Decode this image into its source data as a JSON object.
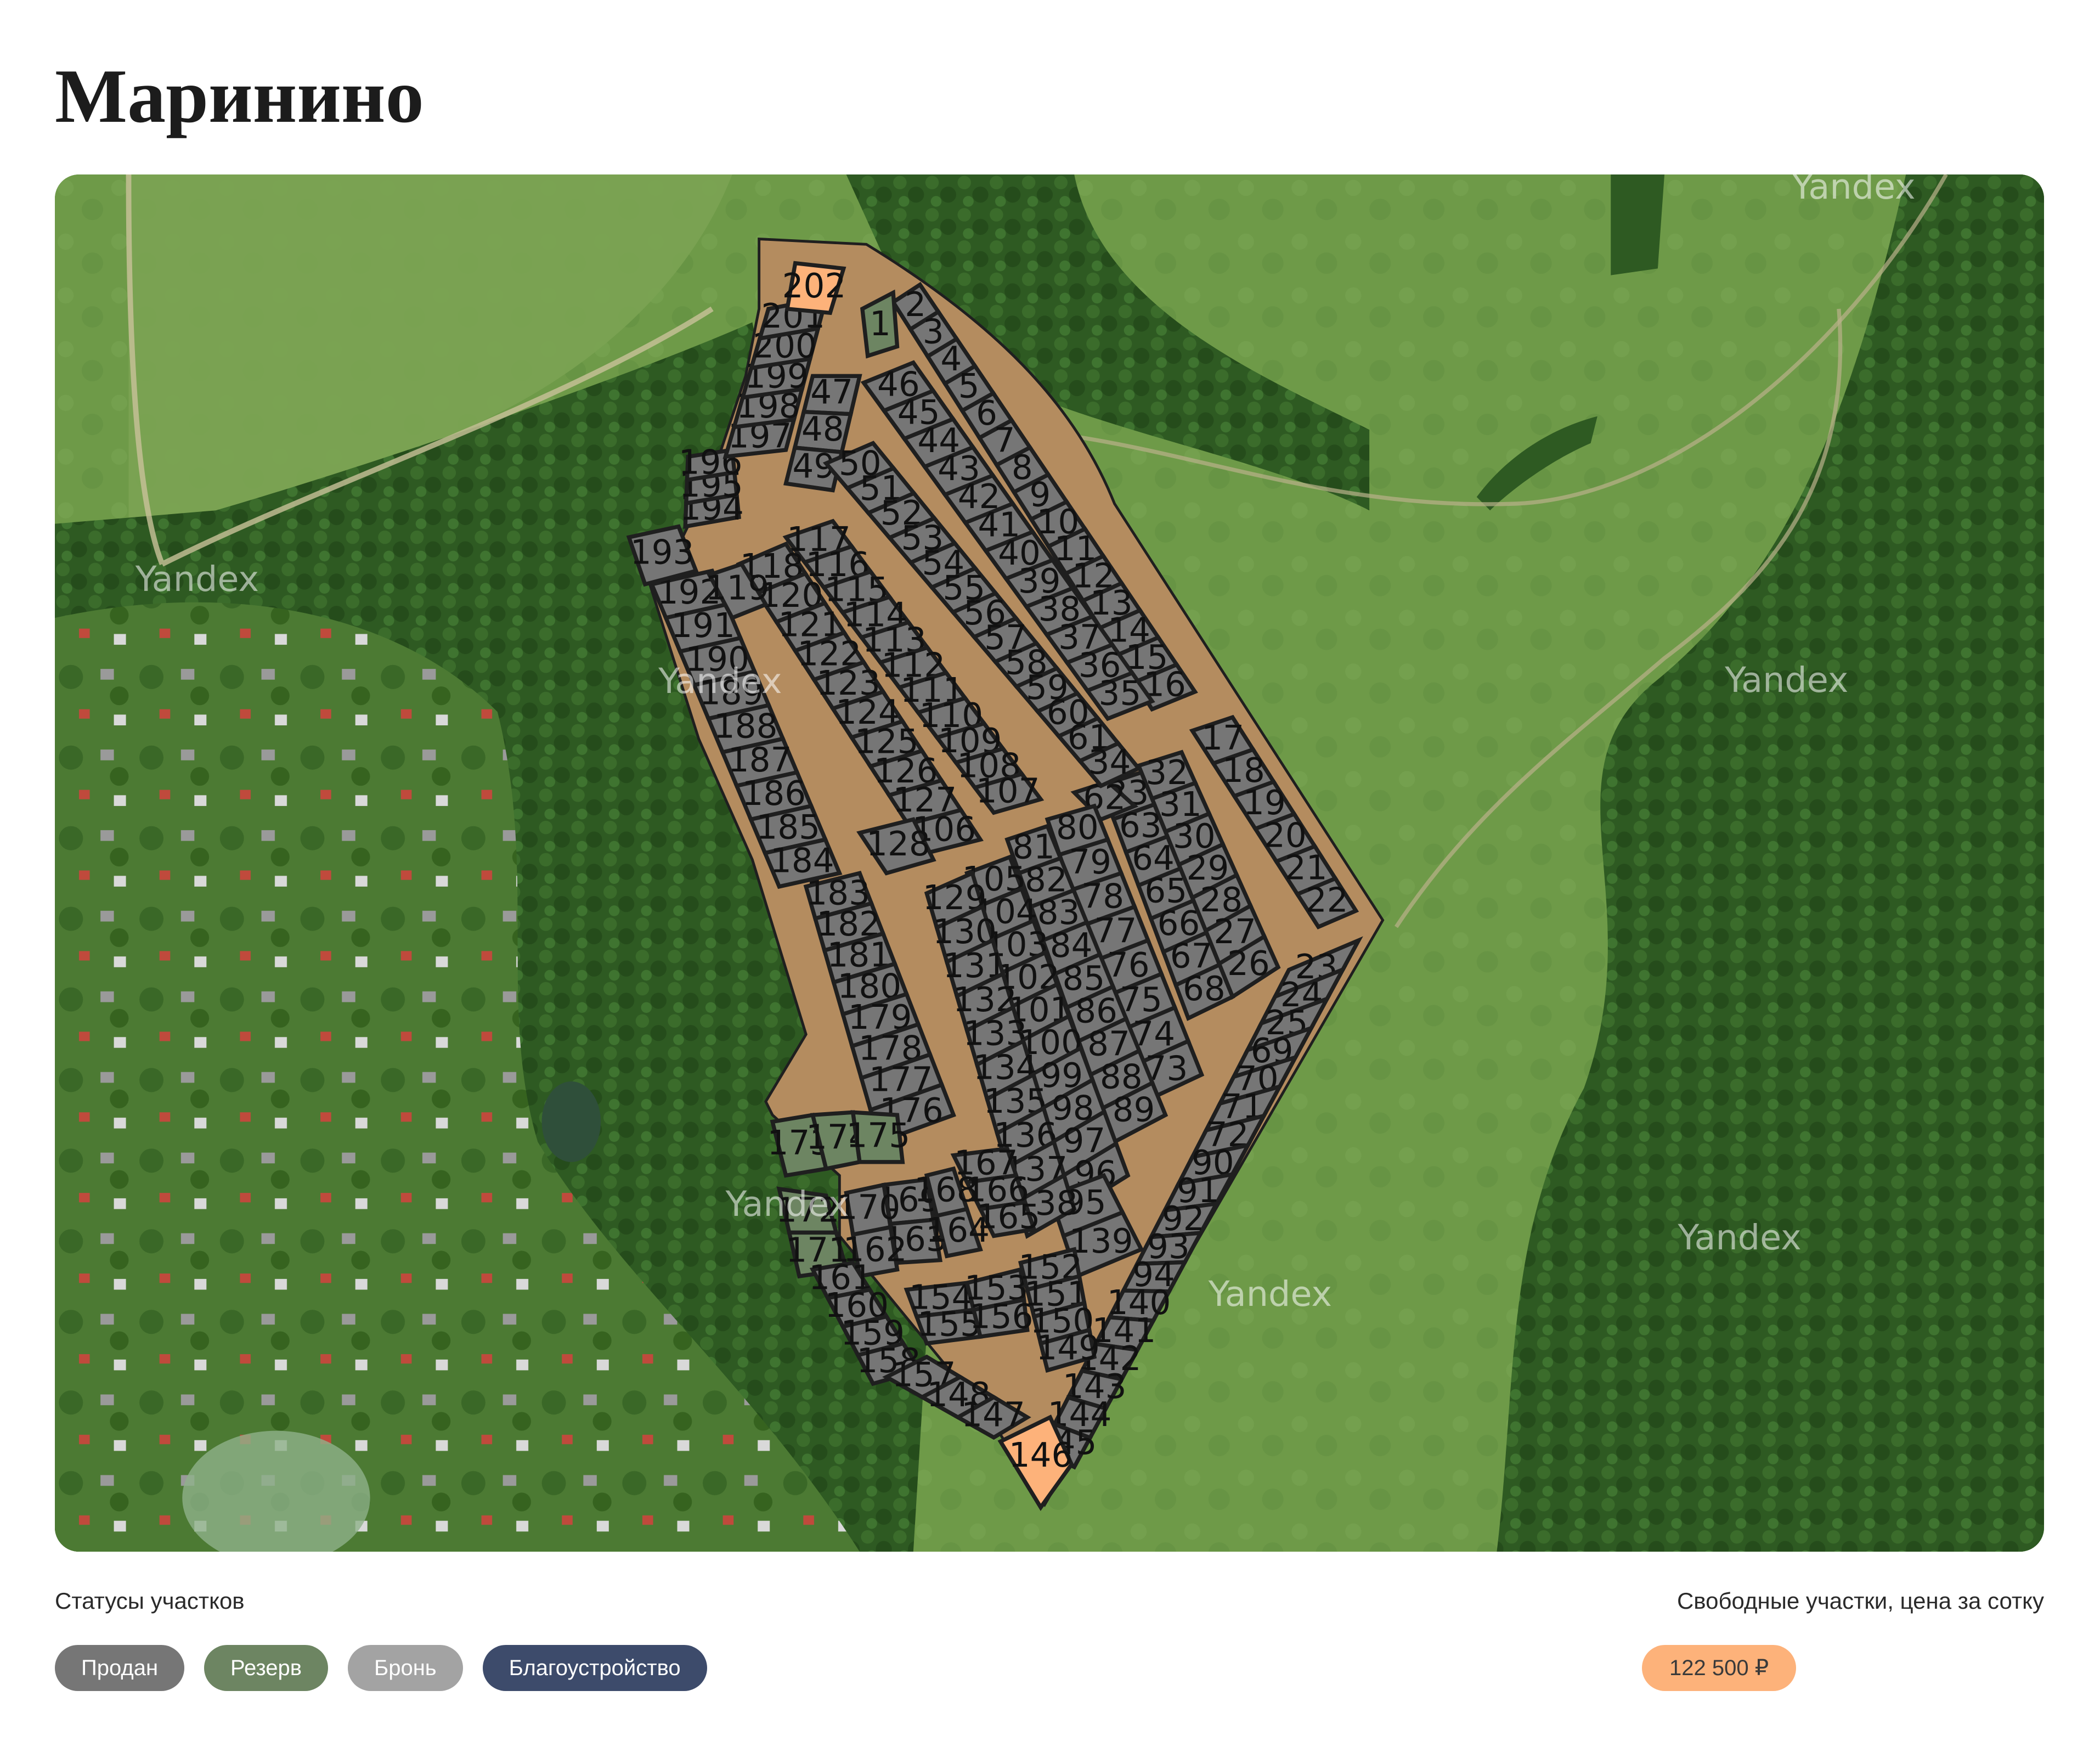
{
  "page": {
    "title": "Маринино"
  },
  "legend": {
    "title": "Статусы участков",
    "statuses": [
      {
        "label": "Продан",
        "color": "#767676"
      },
      {
        "label": "Резерв",
        "color": "#6d8562"
      },
      {
        "label": "Бронь",
        "color": "#a3a3a3"
      },
      {
        "label": "Благоустройство",
        "color": "#3d4b6b"
      }
    ]
  },
  "price": {
    "title": "Свободные участки, цена за сотку",
    "value": "122 500 ₽",
    "color": "#fdb27a"
  },
  "map": {
    "watermark": "Yandex",
    "colors": {
      "sold": "#767676",
      "reserve": "#6d8562",
      "available": "#fdb27a",
      "road": "#b48c5f",
      "field": "#6f9a48",
      "forest": "#2f5a21"
    },
    "plots": [
      {
        "n": "1",
        "s": "reserve"
      },
      {
        "n": "2",
        "s": "sold"
      },
      {
        "n": "3",
        "s": "sold"
      },
      {
        "n": "4",
        "s": "sold"
      },
      {
        "n": "5",
        "s": "sold"
      },
      {
        "n": "6",
        "s": "sold"
      },
      {
        "n": "7",
        "s": "sold"
      },
      {
        "n": "8",
        "s": "sold"
      },
      {
        "n": "9",
        "s": "sold"
      },
      {
        "n": "10",
        "s": "sold"
      },
      {
        "n": "11",
        "s": "sold"
      },
      {
        "n": "12",
        "s": "sold"
      },
      {
        "n": "13",
        "s": "sold"
      },
      {
        "n": "14",
        "s": "sold"
      },
      {
        "n": "15",
        "s": "sold"
      },
      {
        "n": "16",
        "s": "sold"
      },
      {
        "n": "17",
        "s": "sold"
      },
      {
        "n": "18",
        "s": "sold"
      },
      {
        "n": "19",
        "s": "sold"
      },
      {
        "n": "20",
        "s": "sold"
      },
      {
        "n": "21",
        "s": "sold"
      },
      {
        "n": "22",
        "s": "sold"
      },
      {
        "n": "23",
        "s": "sold"
      },
      {
        "n": "24",
        "s": "sold"
      },
      {
        "n": "25",
        "s": "sold"
      },
      {
        "n": "26",
        "s": "sold"
      },
      {
        "n": "27",
        "s": "sold"
      },
      {
        "n": "28",
        "s": "sold"
      },
      {
        "n": "29",
        "s": "sold"
      },
      {
        "n": "30",
        "s": "sold"
      },
      {
        "n": "31",
        "s": "sold"
      },
      {
        "n": "32",
        "s": "sold"
      },
      {
        "n": "33",
        "s": "sold"
      },
      {
        "n": "34",
        "s": "sold"
      },
      {
        "n": "35",
        "s": "sold"
      },
      {
        "n": "36",
        "s": "sold"
      },
      {
        "n": "37",
        "s": "sold"
      },
      {
        "n": "38",
        "s": "sold"
      },
      {
        "n": "39",
        "s": "sold"
      },
      {
        "n": "40",
        "s": "sold"
      },
      {
        "n": "41",
        "s": "sold"
      },
      {
        "n": "42",
        "s": "sold"
      },
      {
        "n": "43",
        "s": "sold"
      },
      {
        "n": "44",
        "s": "sold"
      },
      {
        "n": "45",
        "s": "sold"
      },
      {
        "n": "46",
        "s": "sold"
      },
      {
        "n": "47",
        "s": "sold"
      },
      {
        "n": "48",
        "s": "sold"
      },
      {
        "n": "49",
        "s": "sold"
      },
      {
        "n": "50",
        "s": "sold"
      },
      {
        "n": "51",
        "s": "sold"
      },
      {
        "n": "52",
        "s": "sold"
      },
      {
        "n": "53",
        "s": "sold"
      },
      {
        "n": "54",
        "s": "sold"
      },
      {
        "n": "55",
        "s": "sold"
      },
      {
        "n": "56",
        "s": "sold"
      },
      {
        "n": "57",
        "s": "sold"
      },
      {
        "n": "58",
        "s": "sold"
      },
      {
        "n": "59",
        "s": "sold"
      },
      {
        "n": "60",
        "s": "sold"
      },
      {
        "n": "61",
        "s": "sold"
      },
      {
        "n": "62",
        "s": "sold"
      },
      {
        "n": "63",
        "s": "sold"
      },
      {
        "n": "64",
        "s": "sold"
      },
      {
        "n": "65",
        "s": "sold"
      },
      {
        "n": "66",
        "s": "sold"
      },
      {
        "n": "67",
        "s": "sold"
      },
      {
        "n": "68",
        "s": "sold"
      },
      {
        "n": "69",
        "s": "sold"
      },
      {
        "n": "70",
        "s": "sold"
      },
      {
        "n": "71",
        "s": "sold"
      },
      {
        "n": "72",
        "s": "sold"
      },
      {
        "n": "73",
        "s": "sold"
      },
      {
        "n": "74",
        "s": "sold"
      },
      {
        "n": "75",
        "s": "sold"
      },
      {
        "n": "76",
        "s": "sold"
      },
      {
        "n": "77",
        "s": "sold"
      },
      {
        "n": "78",
        "s": "sold"
      },
      {
        "n": "79",
        "s": "sold"
      },
      {
        "n": "80",
        "s": "sold"
      },
      {
        "n": "81",
        "s": "sold"
      },
      {
        "n": "82",
        "s": "sold"
      },
      {
        "n": "83",
        "s": "sold"
      },
      {
        "n": "84",
        "s": "sold"
      },
      {
        "n": "85",
        "s": "sold"
      },
      {
        "n": "86",
        "s": "sold"
      },
      {
        "n": "87",
        "s": "sold"
      },
      {
        "n": "88",
        "s": "sold"
      },
      {
        "n": "89",
        "s": "sold"
      },
      {
        "n": "90",
        "s": "sold"
      },
      {
        "n": "91",
        "s": "sold"
      },
      {
        "n": "92",
        "s": "sold"
      },
      {
        "n": "93",
        "s": "sold"
      },
      {
        "n": "94",
        "s": "sold"
      },
      {
        "n": "95",
        "s": "sold"
      },
      {
        "n": "96",
        "s": "sold"
      },
      {
        "n": "97",
        "s": "sold"
      },
      {
        "n": "98",
        "s": "sold"
      },
      {
        "n": "99",
        "s": "sold"
      },
      {
        "n": "100",
        "s": "sold"
      },
      {
        "n": "101",
        "s": "sold"
      },
      {
        "n": "102",
        "s": "sold"
      },
      {
        "n": "103",
        "s": "sold"
      },
      {
        "n": "104",
        "s": "sold"
      },
      {
        "n": "105",
        "s": "sold"
      },
      {
        "n": "106",
        "s": "sold"
      },
      {
        "n": "107",
        "s": "sold"
      },
      {
        "n": "108",
        "s": "sold"
      },
      {
        "n": "109",
        "s": "sold"
      },
      {
        "n": "110",
        "s": "sold"
      },
      {
        "n": "111",
        "s": "sold"
      },
      {
        "n": "112",
        "s": "sold"
      },
      {
        "n": "113",
        "s": "sold"
      },
      {
        "n": "114",
        "s": "sold"
      },
      {
        "n": "115",
        "s": "sold"
      },
      {
        "n": "116",
        "s": "sold"
      },
      {
        "n": "117",
        "s": "sold"
      },
      {
        "n": "118",
        "s": "sold"
      },
      {
        "n": "119",
        "s": "sold"
      },
      {
        "n": "120",
        "s": "sold"
      },
      {
        "n": "121",
        "s": "sold"
      },
      {
        "n": "122",
        "s": "sold"
      },
      {
        "n": "123",
        "s": "sold"
      },
      {
        "n": "124",
        "s": "sold"
      },
      {
        "n": "125",
        "s": "sold"
      },
      {
        "n": "126",
        "s": "sold"
      },
      {
        "n": "127",
        "s": "sold"
      },
      {
        "n": "128",
        "s": "sold"
      },
      {
        "n": "129",
        "s": "sold"
      },
      {
        "n": "130",
        "s": "sold"
      },
      {
        "n": "131",
        "s": "sold"
      },
      {
        "n": "132",
        "s": "sold"
      },
      {
        "n": "133",
        "s": "sold"
      },
      {
        "n": "134",
        "s": "sold"
      },
      {
        "n": "135",
        "s": "sold"
      },
      {
        "n": "136",
        "s": "sold"
      },
      {
        "n": "137",
        "s": "sold"
      },
      {
        "n": "138",
        "s": "sold"
      },
      {
        "n": "139",
        "s": "sold"
      },
      {
        "n": "140",
        "s": "sold"
      },
      {
        "n": "141",
        "s": "sold"
      },
      {
        "n": "142",
        "s": "sold"
      },
      {
        "n": "143",
        "s": "sold"
      },
      {
        "n": "144",
        "s": "sold"
      },
      {
        "n": "145",
        "s": "sold"
      },
      {
        "n": "146",
        "s": "available"
      },
      {
        "n": "147",
        "s": "sold"
      },
      {
        "n": "148",
        "s": "sold"
      },
      {
        "n": "149",
        "s": "sold"
      },
      {
        "n": "150",
        "s": "sold"
      },
      {
        "n": "151",
        "s": "sold"
      },
      {
        "n": "152",
        "s": "sold"
      },
      {
        "n": "153",
        "s": "sold"
      },
      {
        "n": "154",
        "s": "sold"
      },
      {
        "n": "155",
        "s": "sold"
      },
      {
        "n": "156",
        "s": "sold"
      },
      {
        "n": "157",
        "s": "sold"
      },
      {
        "n": "158",
        "s": "sold"
      },
      {
        "n": "159",
        "s": "sold"
      },
      {
        "n": "160",
        "s": "sold"
      },
      {
        "n": "161",
        "s": "sold"
      },
      {
        "n": "162",
        "s": "sold"
      },
      {
        "n": "163",
        "s": "sold"
      },
      {
        "n": "164",
        "s": "sold"
      },
      {
        "n": "165",
        "s": "sold"
      },
      {
        "n": "166",
        "s": "sold"
      },
      {
        "n": "167",
        "s": "sold"
      },
      {
        "n": "168",
        "s": "sold"
      },
      {
        "n": "169",
        "s": "sold"
      },
      {
        "n": "170",
        "s": "sold"
      },
      {
        "n": "171",
        "s": "reserve"
      },
      {
        "n": "172",
        "s": "reserve"
      },
      {
        "n": "173",
        "s": "reserve"
      },
      {
        "n": "174",
        "s": "reserve"
      },
      {
        "n": "175",
        "s": "reserve"
      },
      {
        "n": "176",
        "s": "sold"
      },
      {
        "n": "177",
        "s": "sold"
      },
      {
        "n": "178",
        "s": "sold"
      },
      {
        "n": "179",
        "s": "sold"
      },
      {
        "n": "180",
        "s": "sold"
      },
      {
        "n": "181",
        "s": "sold"
      },
      {
        "n": "182",
        "s": "sold"
      },
      {
        "n": "183",
        "s": "sold"
      },
      {
        "n": "184",
        "s": "sold"
      },
      {
        "n": "185",
        "s": "sold"
      },
      {
        "n": "186",
        "s": "sold"
      },
      {
        "n": "187",
        "s": "sold"
      },
      {
        "n": "188",
        "s": "sold"
      },
      {
        "n": "189",
        "s": "sold"
      },
      {
        "n": "190",
        "s": "sold"
      },
      {
        "n": "191",
        "s": "sold"
      },
      {
        "n": "192",
        "s": "sold"
      },
      {
        "n": "193",
        "s": "sold"
      },
      {
        "n": "194",
        "s": "sold"
      },
      {
        "n": "195",
        "s": "sold"
      },
      {
        "n": "196",
        "s": "sold"
      },
      {
        "n": "197",
        "s": "sold"
      },
      {
        "n": "198",
        "s": "sold"
      },
      {
        "n": "199",
        "s": "sold"
      },
      {
        "n": "200",
        "s": "sold"
      },
      {
        "n": "201",
        "s": "sold"
      },
      {
        "n": "202",
        "s": "available"
      }
    ]
  }
}
